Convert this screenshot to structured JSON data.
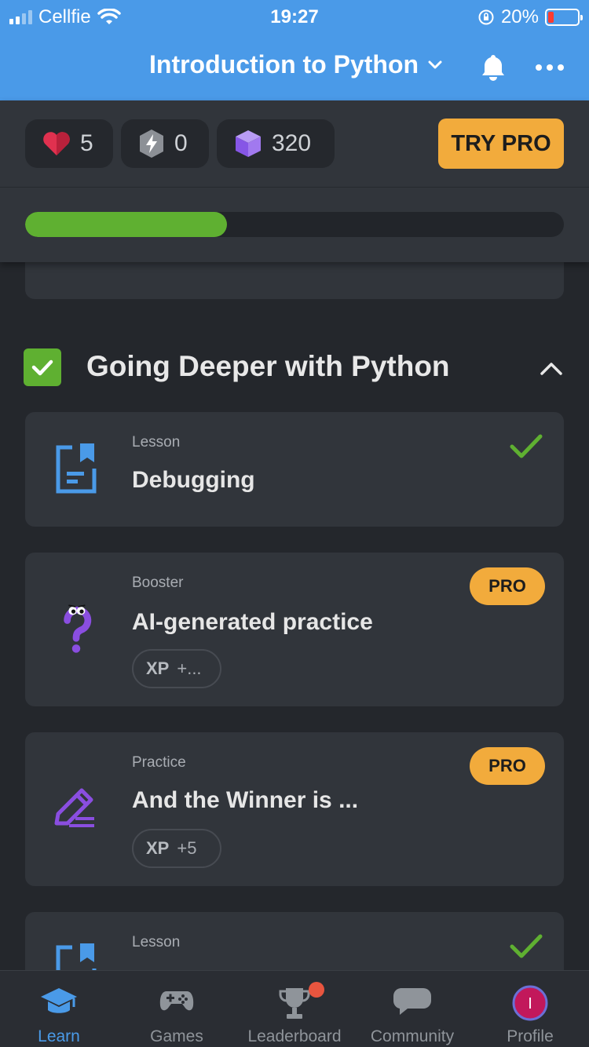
{
  "status_bar": {
    "carrier": "Cellfie",
    "time": "19:27",
    "battery": "20%"
  },
  "header": {
    "course_title": "Introduction to Python"
  },
  "stats": {
    "hearts": "5",
    "bolts": "0",
    "gems": "320",
    "try_pro": "TRY PRO",
    "progress_fraction": 0.375
  },
  "section": {
    "title": "Going Deeper with Python",
    "completed": true
  },
  "items": [
    {
      "kind": "Lesson",
      "title": "Debugging"
    },
    {
      "kind": "Booster",
      "title": "AI-generated practice",
      "badge": "PRO",
      "xp_label": "XP",
      "xp_value": "+..."
    },
    {
      "kind": "Practice",
      "title": "And the Winner is ...",
      "badge": "PRO",
      "xp_label": "XP",
      "xp_value": "+5"
    },
    {
      "kind": "Lesson",
      "title": ""
    }
  ],
  "nav": {
    "learn": "Learn",
    "games": "Games",
    "leaderboard": "Leaderboard",
    "community": "Community",
    "profile": "Profile",
    "profile_initial": "I"
  },
  "colors": {
    "header_blue": "#4a9ae8",
    "accent_green": "#5fb031",
    "pro_orange": "#f2ab3c",
    "card_bg": "#31353b"
  }
}
